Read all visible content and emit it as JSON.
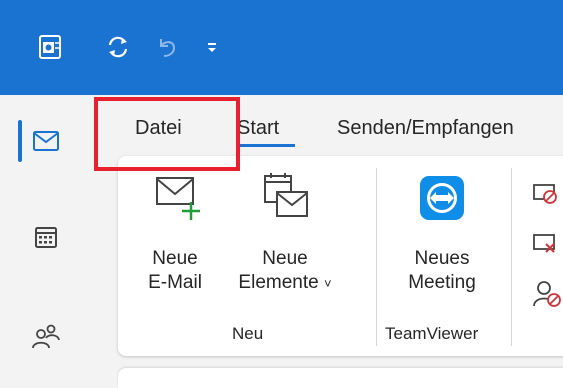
{
  "titlebar": {
    "icons": [
      "outlook-app-icon",
      "sync-icon",
      "undo-icon",
      "customize-qat-icon"
    ],
    "color": "#1a73d1"
  },
  "rail": {
    "items": [
      "mail-icon",
      "calendar-icon",
      "people-icon"
    ],
    "selected": "mail-icon"
  },
  "tabs": [
    {
      "label": "Datei"
    },
    {
      "label": "Start",
      "active": true
    },
    {
      "label": "Senden/Empfangen"
    }
  ],
  "ribbon": {
    "buttons": {
      "new_mail": {
        "line1": "Neue",
        "line2": "E-Mail"
      },
      "new_items": {
        "line1": "Neue",
        "line2": "Elemente",
        "dropdown": "˅"
      },
      "new_meeting": {
        "line1": "Neues",
        "line2": "Meeting"
      }
    },
    "groups": {
      "new": "Neu",
      "teamviewer": "TeamViewer"
    }
  },
  "highlight_color": "#e8212e"
}
